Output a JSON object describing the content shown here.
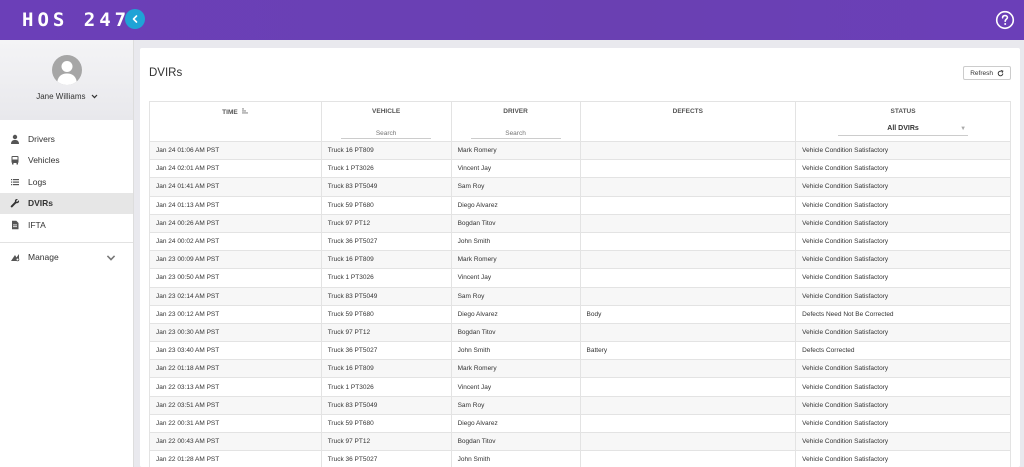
{
  "header": {
    "logo": "HOS 247"
  },
  "sidebar": {
    "user_name": "Jane Williams",
    "items": [
      {
        "label": "Drivers"
      },
      {
        "label": "Vehicles"
      },
      {
        "label": "Logs"
      },
      {
        "label": "DVIRs"
      },
      {
        "label": "IFTA"
      },
      {
        "label": "Manage"
      }
    ]
  },
  "main": {
    "title": "DVIRs",
    "refresh_label": "Refresh",
    "columns": {
      "time": "TIME",
      "vehicle": "VEHICLE",
      "driver": "DRIVER",
      "defects": "DEFECTS",
      "status": "STATUS"
    },
    "vehicle_search_placeholder": "Search",
    "driver_search_placeholder": "Search",
    "status_filter_value": "All DVIRs",
    "rows": [
      {
        "time": "Jan 24 01:06 AM PST",
        "vehicle": "Truck 16 PT809",
        "driver": "Mark Romery",
        "defects": "",
        "status": "Vehicle Condition Satisfactory"
      },
      {
        "time": "Jan 24 02:01 AM PST",
        "vehicle": "Truck 1 PT3026",
        "driver": "Vincent Jay",
        "defects": "",
        "status": "Vehicle Condition Satisfactory"
      },
      {
        "time": "Jan 24 01:41 AM PST",
        "vehicle": "Truck 83 PT5049",
        "driver": "Sam Roy",
        "defects": "",
        "status": "Vehicle Condition Satisfactory"
      },
      {
        "time": "Jan 24 01:13 AM PST",
        "vehicle": "Truck 59 PT680",
        "driver": "Diego Alvarez",
        "defects": "",
        "status": "Vehicle Condition Satisfactory"
      },
      {
        "time": "Jan 24 00:26 AM PST",
        "vehicle": "Truck 97 PT12",
        "driver": "Bogdan Titov",
        "defects": "",
        "status": "Vehicle Condition Satisfactory"
      },
      {
        "time": "Jan 24 00:02 AM PST",
        "vehicle": "Truck 36 PT5027",
        "driver": "John Smith",
        "defects": "",
        "status": "Vehicle Condition Satisfactory"
      },
      {
        "time": "Jan 23 00:09 AM PST",
        "vehicle": "Truck 16 PT809",
        "driver": "Mark Romery",
        "defects": "",
        "status": "Vehicle Condition Satisfactory"
      },
      {
        "time": "Jan 23 00:50 AM PST",
        "vehicle": "Truck 1 PT3026",
        "driver": "Vincent Jay",
        "defects": "",
        "status": "Vehicle Condition Satisfactory"
      },
      {
        "time": "Jan 23 02:14 AM PST",
        "vehicle": "Truck 83 PT5049",
        "driver": "Sam Roy",
        "defects": "",
        "status": "Vehicle Condition Satisfactory"
      },
      {
        "time": "Jan 23 00:12 AM PST",
        "vehicle": "Truck 59 PT680",
        "driver": "Diego Alvarez",
        "defects": "Body",
        "status": "Defects Need Not Be Corrected"
      },
      {
        "time": "Jan 23 00:30 AM PST",
        "vehicle": "Truck 97 PT12",
        "driver": "Bogdan Titov",
        "defects": "",
        "status": "Vehicle Condition Satisfactory"
      },
      {
        "time": "Jan 23 03:40 AM PST",
        "vehicle": "Truck 36 PT5027",
        "driver": "John Smith",
        "defects": "Battery",
        "status": "Defects Corrected"
      },
      {
        "time": "Jan 22 01:18 AM PST",
        "vehicle": "Truck 16 PT809",
        "driver": "Mark Romery",
        "defects": "",
        "status": "Vehicle Condition Satisfactory"
      },
      {
        "time": "Jan 22 03:13 AM PST",
        "vehicle": "Truck 1 PT3026",
        "driver": "Vincent Jay",
        "defects": "",
        "status": "Vehicle Condition Satisfactory"
      },
      {
        "time": "Jan 22 03:51 AM PST",
        "vehicle": "Truck 83 PT5049",
        "driver": "Sam Roy",
        "defects": "",
        "status": "Vehicle Condition Satisfactory"
      },
      {
        "time": "Jan 22 00:31 AM PST",
        "vehicle": "Truck 59 PT680",
        "driver": "Diego Alvarez",
        "defects": "",
        "status": "Vehicle Condition Satisfactory"
      },
      {
        "time": "Jan 22 00:43 AM PST",
        "vehicle": "Truck 97 PT12",
        "driver": "Bogdan Titov",
        "defects": "",
        "status": "Vehicle Condition Satisfactory"
      },
      {
        "time": "Jan 22 01:28 AM PST",
        "vehicle": "Truck 36 PT5027",
        "driver": "John Smith",
        "defects": "",
        "status": "Vehicle Condition Satisfactory"
      }
    ]
  },
  "icons": {
    "collapse": "chevron-left-icon",
    "help": "help-circle-icon",
    "avatar": "user-avatar-icon",
    "sort": "sort-icon",
    "refresh": "refresh-icon"
  },
  "colors": {
    "header": "#6a3fb5",
    "accent": "#1fa3d6",
    "defect": "#c0392b"
  }
}
